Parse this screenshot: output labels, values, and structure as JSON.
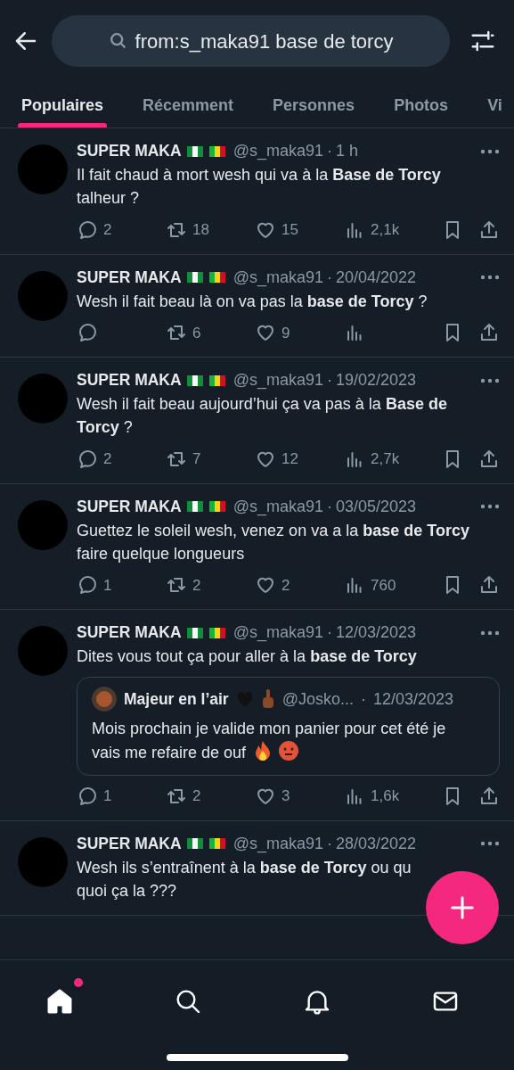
{
  "search": {
    "value": "from:s_maka91 base de torcy"
  },
  "tabs": [
    {
      "label": "Populaires",
      "selected": true
    },
    {
      "label": "Récemment",
      "selected": false
    },
    {
      "label": "Personnes",
      "selected": false
    },
    {
      "label": "Photos",
      "selected": false
    },
    {
      "label": "Vi",
      "selected": false
    }
  ],
  "tweets": [
    {
      "name": "SUPER MAKA",
      "handle": "@s_maka91",
      "sep": "·",
      "time": "1 h",
      "lines": [
        "Il fait chaud à mort wesh qui va à la **Base de Torcy**",
        "talheur ?"
      ],
      "replies": "2",
      "reposts": "18",
      "likes": "15",
      "views": "2,1k"
    },
    {
      "name": "SUPER MAKA",
      "handle": "@s_maka91",
      "sep": "·",
      "time": "20/04/2022",
      "lines": [
        "Wesh il fait beau là on va pas la **base de Torcy** ?"
      ],
      "reposts": "6",
      "likes": "9"
    },
    {
      "name": "SUPER MAKA",
      "handle": "@s_maka91",
      "sep": "·",
      "time": "19/02/2023",
      "lines": [
        "Wesh il fait beau aujourd’hui ça va pas à la **Base de**",
        "**Torcy** ?"
      ],
      "replies": "2",
      "reposts": "7",
      "likes": "12",
      "views": "2,7k"
    },
    {
      "name": "SUPER MAKA",
      "handle": "@s_maka91",
      "sep": "·",
      "time": "03/05/2023",
      "lines": [
        "Guettez le soleil wesh, venez on va a la **base de Torcy**",
        "faire quelque longueurs"
      ],
      "replies": "1",
      "reposts": "2",
      "likes": "2",
      "views": "760"
    },
    {
      "name": "SUPER MAKA",
      "handle": "@s_maka91",
      "sep": "·",
      "time": "12/03/2023",
      "lines": [
        "Dites vous tout ça pour aller à la **base de Torcy**"
      ],
      "quote": {
        "name": "Majeur en l’air",
        "handle": "@Josko...",
        "sep": "·",
        "time": "12/03/2023",
        "lines": [
          "Mois prochain je valide mon panier pour cet été je",
          "vais me refaire de ouf"
        ]
      },
      "replies": "1",
      "reposts": "2",
      "likes": "3",
      "views": "1,6k"
    },
    {
      "name": "SUPER MAKA",
      "handle": "@s_maka91",
      "sep": "·",
      "time": "28/03/2022",
      "lines": [
        "Wesh ils s’entraînent à la **base de Torcy** ou qu",
        "quoi ça la ???"
      ]
    }
  ],
  "nav": [
    {
      "kind": "home",
      "selected": true,
      "badge": true
    },
    {
      "kind": "search",
      "selected": false
    },
    {
      "kind": "bell",
      "selected": false
    },
    {
      "kind": "mail",
      "selected": false
    }
  ]
}
